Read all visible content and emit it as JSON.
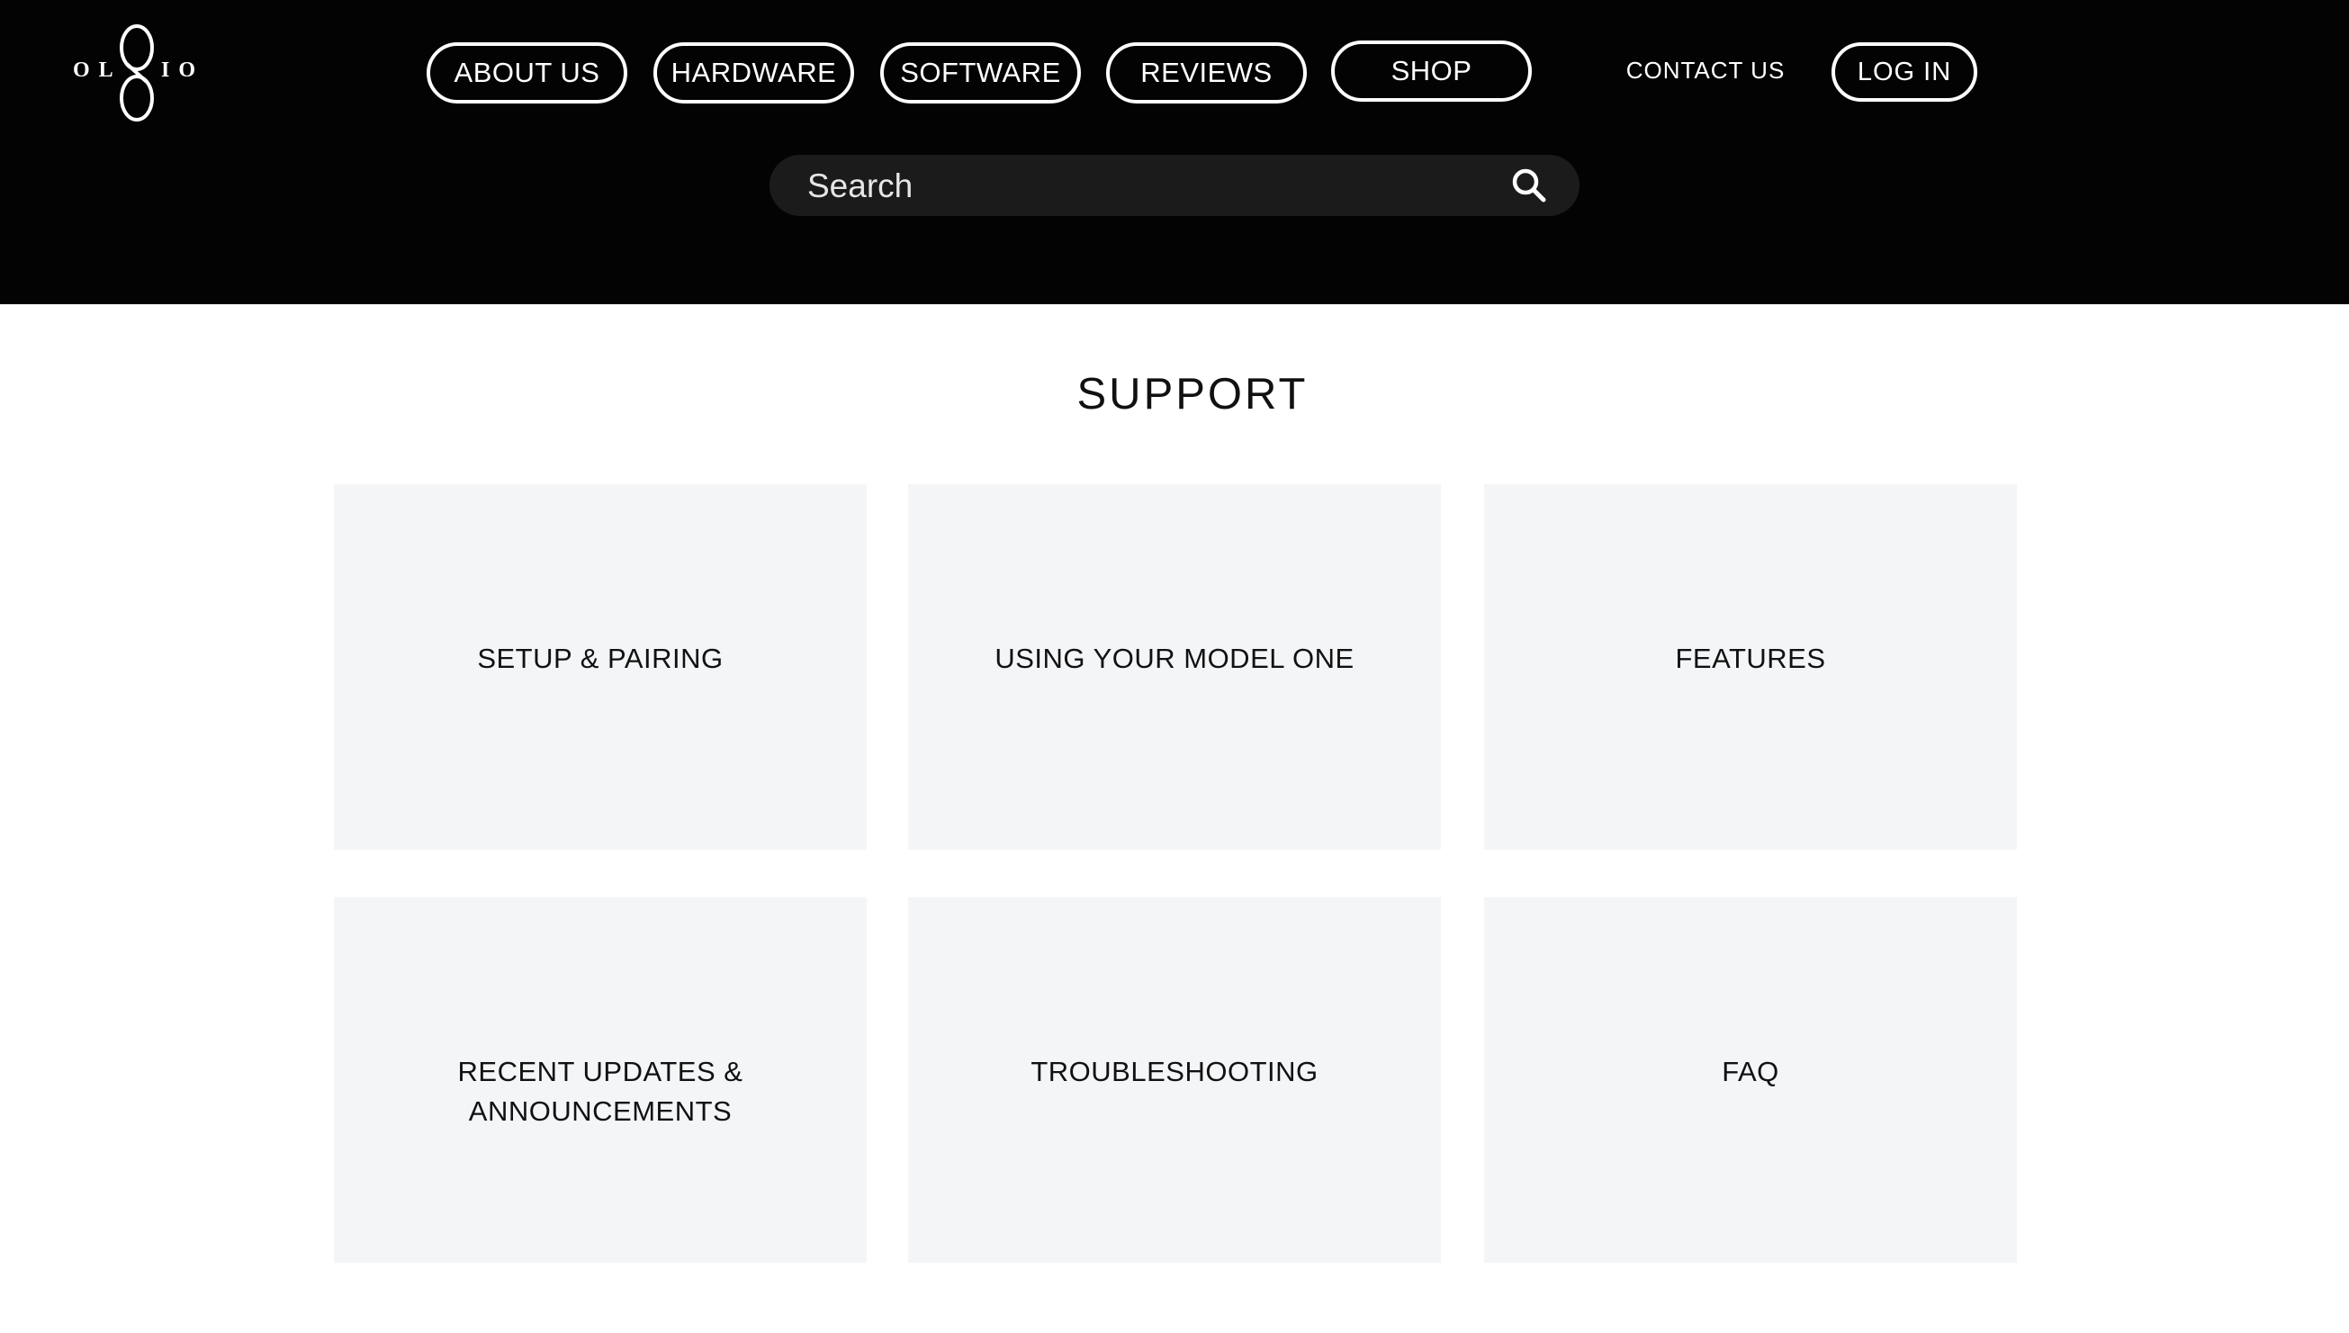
{
  "brand": {
    "logo_text": "OL8IO"
  },
  "nav": {
    "items": [
      {
        "label": "ABOUT US"
      },
      {
        "label": "HARDWARE"
      },
      {
        "label": "SOFTWARE"
      },
      {
        "label": "REVIEWS"
      },
      {
        "label": "SHOP"
      }
    ],
    "contact_label": "CONTACT US",
    "login_label": "LOG IN"
  },
  "search": {
    "placeholder": "Search",
    "icon": "search-icon"
  },
  "main": {
    "title": "SUPPORT",
    "cards": [
      {
        "label": "SETUP & PAIRING"
      },
      {
        "label": "USING YOUR MODEL ONE"
      },
      {
        "label": "FEATURES"
      },
      {
        "label": "RECENT UPDATES &\nANNOUNCEMENTS"
      },
      {
        "label": "TROUBLESHOOTING"
      },
      {
        "label": "FAQ"
      }
    ]
  },
  "colors": {
    "header_bg": "#030303",
    "search_bg": "#1b1b1b",
    "card_bg": "#f4f5f7",
    "text_dark": "#111111",
    "text_light": "#ffffff"
  }
}
